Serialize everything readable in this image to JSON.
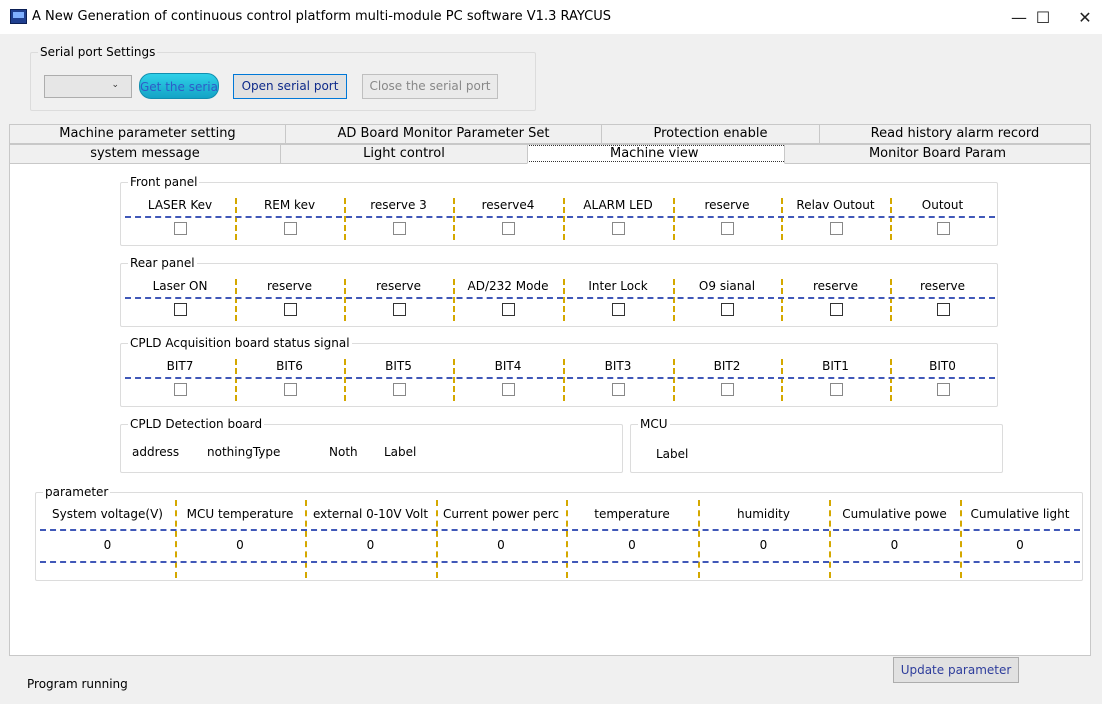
{
  "window": {
    "title": "A New Generation of continuous control platform multi-module PC software V1.3 RAYCUS",
    "min": "—",
    "max": "☐",
    "close": "✕"
  },
  "serial": {
    "legend": "Serial port Settings",
    "combo_value": "",
    "combo_arrow": "⌄",
    "get_label": "Get the serial",
    "open_label": "Open serial port",
    "close_label": "Close the serial port"
  },
  "tabs_row1": [
    "Machine parameter setting",
    "AD Board Monitor Parameter Set",
    "Protection enable",
    "Read history alarm record"
  ],
  "tabs_row2": [
    "system message",
    "Light control",
    "Machine view",
    "Monitor Board Param"
  ],
  "front_panel": {
    "legend": "Front panel",
    "columns": [
      "LASER Kev",
      "REM kev",
      "reserve 3",
      "reserve4",
      "ALARM LED",
      "reserve",
      "Relav Outout",
      "Outout"
    ]
  },
  "rear_panel": {
    "legend": "Rear panel",
    "columns": [
      "Laser ON",
      "reserve",
      "reserve",
      "AD/232 Mode",
      "Inter Lock",
      "O9 sianal",
      "reserve",
      "reserve"
    ]
  },
  "cpld_status": {
    "legend": "CPLD  Acquisition board status signal",
    "columns": [
      "BIT7",
      "BIT6",
      "BIT5",
      "BIT4",
      "BIT3",
      "BIT2",
      "BIT1",
      "BIT0"
    ]
  },
  "cpld_detect": {
    "legend": "CPLD Detection board",
    "address": "address",
    "type": "nothingType",
    "noth": "Noth",
    "label": "Label"
  },
  "mcu": {
    "legend": "MCU",
    "label": "Label"
  },
  "parameter": {
    "legend": "parameter",
    "columns": [
      "System voltage(V)",
      "MCU temperature",
      "external 0-10V Volt",
      "Current power perc",
      "temperature",
      "humidity",
      "Cumulative powe",
      "Cumulative light"
    ],
    "values": [
      "0",
      "0",
      "0",
      "0",
      "0",
      "0",
      "0",
      "0"
    ]
  },
  "update_label": "Update parameter",
  "status_text": "Program running"
}
